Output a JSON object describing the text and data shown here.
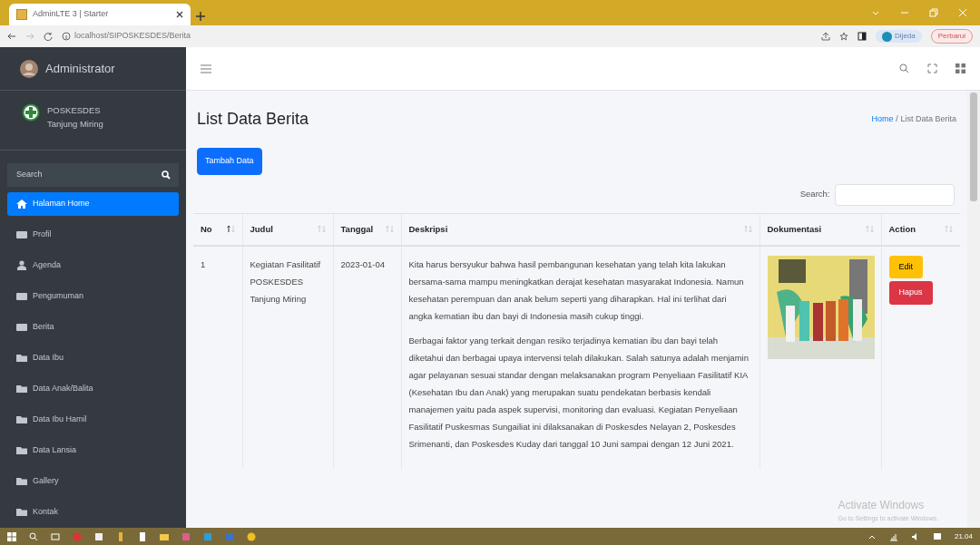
{
  "browser": {
    "tab_title": "AdminLTE 3 | Starter",
    "url": "localhost/SIPOSKESDES/Berita",
    "profile_status": "Dijeda",
    "update_button": "Perbarui"
  },
  "sidebar": {
    "user": "Administrator",
    "brand_line1": "POSKESDES",
    "brand_line2": "Tanjung Miring",
    "search_placeholder": "Search",
    "items": [
      {
        "label": "Halaman Home",
        "kind": "home",
        "selected": true
      },
      {
        "label": "Profil",
        "kind": "card",
        "selected": false
      },
      {
        "label": "Agenda",
        "kind": "user",
        "selected": false
      },
      {
        "label": "Pengumuman",
        "kind": "card",
        "selected": false
      },
      {
        "label": "Berita",
        "kind": "card",
        "selected": false
      },
      {
        "label": "Data Ibu",
        "kind": "folder",
        "selected": false
      },
      {
        "label": "Data Anak/Balita",
        "kind": "folder",
        "selected": false
      },
      {
        "label": "Data Ibu Hamil",
        "kind": "folder",
        "selected": false
      },
      {
        "label": "Data Lansia",
        "kind": "folder",
        "selected": false
      },
      {
        "label": "Gallery",
        "kind": "folder",
        "selected": false
      },
      {
        "label": "Kontak",
        "kind": "folder",
        "selected": false
      }
    ]
  },
  "page": {
    "title": "List Data Berita",
    "breadcrumb": [
      "Home",
      "List Data Berita"
    ],
    "breadcrumb_separator": "/",
    "add_button": "Tambah Data",
    "search_label": "Search:"
  },
  "table": {
    "columns": [
      {
        "label": "No",
        "sorted": true
      },
      {
        "label": "Judul",
        "sorted": false
      },
      {
        "label": "Tanggal",
        "sorted": false
      },
      {
        "label": "Deskripsi",
        "sorted": false
      },
      {
        "label": "Dokumentasi",
        "sorted": false
      },
      {
        "label": "Action",
        "sorted": false
      }
    ],
    "rows": [
      {
        "no": "1",
        "judul": "Kegiatan Fasilitatif POSKESDES Tanjung Miring",
        "tanggal": "2023-01-04",
        "deskripsi": [
          "Kita harus bersyukur bahwa hasil pembangunan kesehatan yang telah kita lakukan bersama-sama mampu meningkatkan derajat kesehatan masyarakat Indonesia. Namun kesehatan perempuan dan anak belum seperti yang diharapkan. Hal ini terlihat dari angka kematian ibu dan bayi di Indonesia masih cukup tinggi.",
          "Berbagai faktor yang terkait dengan resiko terjadinya kematian ibu dan bayi telah diketahui dan berbagai upaya intervensi telah dilakukan. Salah satunya adalah menjamin agar pelayanan sesuai standar dengan melaksanakan program Penyeliaan Fasilitatif KIA (Kesehatan Ibu dan Anak) yang merupakan suatu pendekatan berbasis kendali manajemen yaitu pada aspek supervisi, monitoring dan evaluasi. Kegiatan Penyeliaan Fasilitatif Puskesmas Sungailiat ini dilaksanakan di Poskesdes Nelayan 2, Poskesdes Srimenanti, dan Poskesdes Kuday dari tanggal 10 Juni sampai dengan 12 Juni 2021."
        ],
        "actions": [
          "Edit",
          "Hapus"
        ]
      }
    ]
  },
  "watermark": {
    "line1": "Activate Windows",
    "line2": "Go to Settings to activate Windows."
  },
  "taskbar": {
    "time": "21.04"
  }
}
